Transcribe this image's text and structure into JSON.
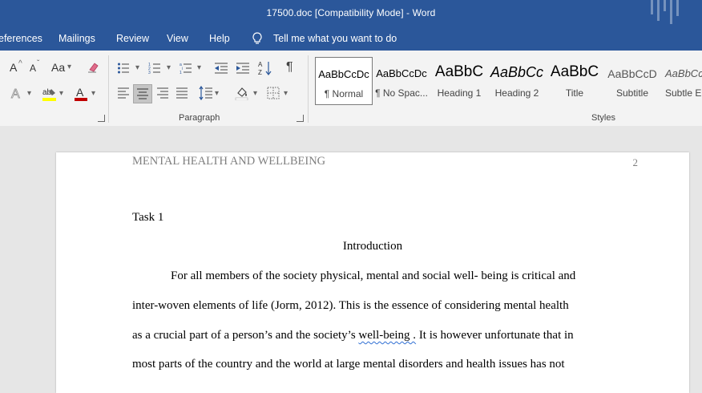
{
  "window": {
    "title": "17500.doc [Compatibility Mode]  -  Word"
  },
  "menu": {
    "items": [
      "eferences",
      "Mailings",
      "Review",
      "View",
      "Help"
    ],
    "tell_me": "Tell me what you want to do"
  },
  "ribbon": {
    "font_group": {
      "grow_label": "A",
      "shrink_label": "A",
      "case_label": "Aa"
    },
    "paragraph_group": {
      "label": "Paragraph"
    },
    "styles_group": {
      "label": "Styles",
      "items": [
        {
          "sample": "AaBbCcDc",
          "label": "¶ Normal"
        },
        {
          "sample": "AaBbCcDc",
          "label": "¶ No Spac..."
        },
        {
          "sample": "AaBbC",
          "label": "Heading 1"
        },
        {
          "sample": "AaBbCc",
          "label": "Heading 2"
        },
        {
          "sample": "AaBbC",
          "label": "Title"
        },
        {
          "sample": "AaBbCcD",
          "label": "Subtitle"
        },
        {
          "sample": "AaBbCcD",
          "label": "Subtle Em"
        }
      ]
    }
  },
  "document": {
    "header": "MENTAL HEALTH AND WELLBEING",
    "page_number": "2",
    "task": "Task 1",
    "heading": "Introduction",
    "lines": [
      "For all members of the society physical, mental and social well- being is critical and",
      "inter-woven elements of life (Jorm, 2012).  This is the essence of considering mental health",
      "as a crucial part of a person’s and the society’s ",
      "It is however unfortunate that in",
      "most parts of the country and the world at large mental disorders and health issues has not"
    ],
    "flagged_word": "well-being ."
  },
  "colors": {
    "title_bar": "#2b579a",
    "ribbon": "#f3f3f3",
    "page_bg": "#e6e6e6",
    "font_red": "#c00000",
    "highlight_yellow": "#ffff00"
  }
}
